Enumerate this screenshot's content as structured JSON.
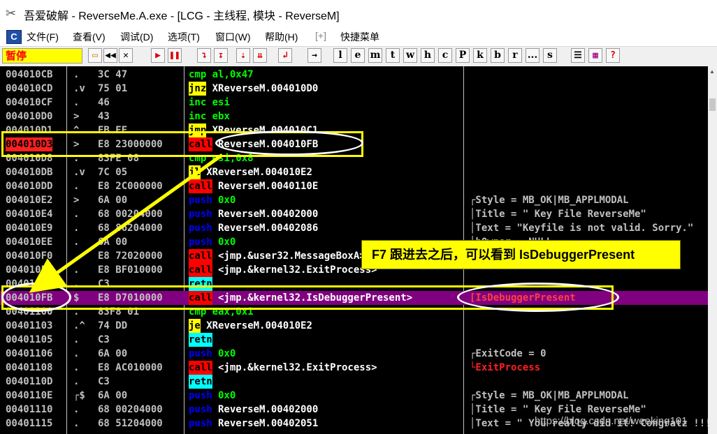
{
  "window": {
    "title": "吾爱破解 - ReverseMe.A.exe - [LCG - 主线程, 模块 - ReverseM]"
  },
  "menu": {
    "file": "文件(F)",
    "view": "查看(V)",
    "debug": "调试(D)",
    "options": "选项(T)",
    "window": "窗口(W)",
    "help": "帮助(H)",
    "plus": "[+]",
    "quick": "快捷菜单"
  },
  "toolbar": {
    "status": "暂停",
    "letters": [
      "l",
      "e",
      "m",
      "t",
      "w",
      "h",
      "c",
      "P",
      "k",
      "b",
      "r",
      "...",
      "s"
    ],
    "question": "?"
  },
  "disasm": {
    "rows": [
      {
        "addr": "004010CB",
        "mark": ".",
        "hex": "3C 47",
        "mn": "cmp",
        "op": "al,0x47",
        "style": "plain"
      },
      {
        "addr": "004010CD",
        "mark": ".v",
        "hex": "75 01",
        "mn": "jnz",
        "op": "XReverseM.004010D0",
        "style": "jump"
      },
      {
        "addr": "004010CF",
        "mark": ".",
        "hex": "46",
        "mn": "inc",
        "op": "esi",
        "style": "inc"
      },
      {
        "addr": "004010D0",
        "mark": ">",
        "hex": "43",
        "mn": "inc",
        "op": "ebx",
        "style": "inc"
      },
      {
        "addr": "004010D1",
        "mark": "^",
        "hex": "EB EE",
        "mn": "jmp",
        "op": "XReverseM.004010C1",
        "style": "jump"
      },
      {
        "addr": "004010D3",
        "mark": ">",
        "hex": "E8 23000000",
        "mn": "call",
        "op": "ReverseM.004010FB",
        "style": "call",
        "hl": true
      },
      {
        "addr": "004010D8",
        "mark": ".",
        "hex": "83FE 08",
        "mn": "cmp",
        "op": "esi,0x8",
        "style": "plain"
      },
      {
        "addr": "004010DB",
        "mark": ".v",
        "hex": "7C 05",
        "mn": "jl",
        "op": "XReverseM.004010E2",
        "style": "jump"
      },
      {
        "addr": "004010DD",
        "mark": ".",
        "hex": "E8 2C000000",
        "mn": "call",
        "op": "ReverseM.0040110E",
        "style": "call"
      },
      {
        "addr": "004010E2",
        "mark": ">",
        "hex": "6A 00",
        "mn": "push",
        "op": "0x0",
        "style": "push",
        "cmt": "┌Style = MB_OK|MB_APPLMODAL"
      },
      {
        "addr": "004010E4",
        "mark": ".",
        "hex": "68 00204000",
        "mn": "push",
        "op": "ReverseM.00402000",
        "style": "push",
        "cmt": "│Title = \" Key File ReverseMe\""
      },
      {
        "addr": "004010E9",
        "mark": ".",
        "hex": "68 86204000",
        "mn": "push",
        "op": "ReverseM.00402086",
        "style": "push",
        "cmt": "│Text = \"Keyfile is not valid. Sorry.\""
      },
      {
        "addr": "004010EE",
        "mark": ".",
        "hex": "6A 00",
        "mn": "push",
        "op": "0x0",
        "style": "push",
        "cmt": "│hOwner = NULL"
      },
      {
        "addr": "004010F0",
        "mark": ".",
        "hex": "E8 72020000",
        "mn": "call",
        "op": "<jmp.&user32.MessageBoxA>",
        "style": "call"
      },
      {
        "addr": "004010F5",
        "mark": ".",
        "hex": "E8 BF010000",
        "mn": "call",
        "op": "<jmp.&kernel32.ExitProcess>",
        "style": "call"
      },
      {
        "addr": "004010FA",
        "mark": ".",
        "hex": "C3",
        "mn": "retn",
        "op": "",
        "style": "ret"
      },
      {
        "addr": "004010FB",
        "mark": "$",
        "hex": "E8 D7010000",
        "mn": "call",
        "op": "<jmp.&kernel32.IsDebuggerPresent>",
        "style": "call",
        "sel": true,
        "cmt": "[IsDebuggerPresent"
      },
      {
        "addr": "00401100",
        "mark": ".",
        "hex": "83F8 01",
        "mn": "cmp",
        "op": "eax,0x1",
        "style": "plain"
      },
      {
        "addr": "00401103",
        "mark": ".^",
        "hex": "74 DD",
        "mn": "je",
        "op": "XReverseM.004010E2",
        "style": "jump"
      },
      {
        "addr": "00401105",
        "mark": ".",
        "hex": "C3",
        "mn": "retn",
        "op": "",
        "style": "ret"
      },
      {
        "addr": "00401106",
        "mark": ".",
        "hex": "6A 00",
        "mn": "push",
        "op": "0x0",
        "style": "push",
        "cmt": "┌ExitCode = 0"
      },
      {
        "addr": "00401108",
        "mark": ".",
        "hex": "E8 AC010000",
        "mn": "call",
        "op": "<jmp.&kernel32.ExitProcess>",
        "style": "call",
        "cmt": "└ExitProcess",
        "cmtRed": true
      },
      {
        "addr": "0040110D",
        "mark": ".",
        "hex": "C3",
        "mn": "retn",
        "op": "",
        "style": "ret"
      },
      {
        "addr": "0040110E",
        "mark": "┌$",
        "hex": "6A 00",
        "mn": "push",
        "op": "0x0",
        "style": "push",
        "cmt": "┌Style = MB_OK|MB_APPLMODAL"
      },
      {
        "addr": "00401110",
        "mark": ".",
        "hex": "68 00204000",
        "mn": "push",
        "op": "ReverseM.00402000",
        "style": "push",
        "cmt": "│Title = \" Key File ReverseMe\""
      },
      {
        "addr": "00401115",
        "mark": ".",
        "hex": "68 51204000",
        "mn": "push",
        "op": "ReverseM.00402051",
        "style": "push",
        "cmt": "│Text = \" You really did it! Congratz !!!\""
      }
    ]
  },
  "annotation": {
    "callout_key": "F7",
    "callout_text": "跟进去之后，可以看到 IsDebuggerPresent"
  },
  "watermark": "https://blog.csdn.net/weeking101",
  "colors": {
    "call_bg": "#ff0000",
    "jump_bg": "#ffff00",
    "ret_bg": "#00ffff",
    "push_fg": "#0000ff",
    "selected_row": "#800080",
    "annotation": "#ffff00"
  }
}
